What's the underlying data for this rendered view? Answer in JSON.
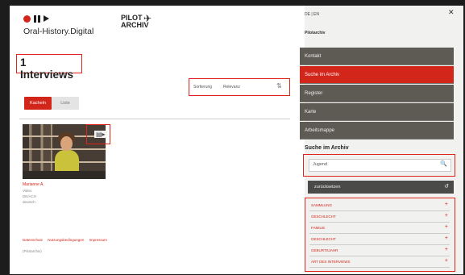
{
  "header": {
    "brand": "Oral-History.Digital",
    "pilot_line1": "PILOT",
    "pilot_line2": "ARCHIV",
    "plane_icon": "✈"
  },
  "main": {
    "interview_count": "1 Interviews",
    "sort": {
      "label": "Sortierung",
      "value": "Relevanz",
      "icon": "⇅"
    },
    "buttons": {
      "primary": "Kacheln",
      "secondary": "Liste"
    },
    "interview": {
      "name": "Marianne A.",
      "meta": [
        "Video",
        "DE/ACH",
        "deutsch"
      ],
      "overlay_icon": "▤▸"
    },
    "footer_links": [
      "Datenschutz",
      "Nutzungsbedingungen",
      "Impressum"
    ],
    "footer_note": "(Pilotarchiv)"
  },
  "sidebar": {
    "lang": "DE | EN",
    "close_icon": "✕",
    "archive_label": "Pilotarchiv",
    "nav": [
      "Kontakt",
      "Suche im Archiv",
      "Register",
      "Karte",
      "Arbeitsmappe"
    ],
    "active_index": 1,
    "search": {
      "title": "Suche im Archiv",
      "value": "Jugend",
      "icon": "🔍",
      "reset_label": "zurücksetzen",
      "reset_icon": "↺"
    },
    "filters": [
      "SAMMLUNG",
      "GESCHLECHT",
      "FAMILIE",
      "GESCHLECHT",
      "GEBURTSJAHR",
      "ART DES INTERVIEWS"
    ]
  },
  "colors": {
    "accent": "#d3261b",
    "nav": "#5e5b55",
    "background": "#1c1c1c"
  }
}
